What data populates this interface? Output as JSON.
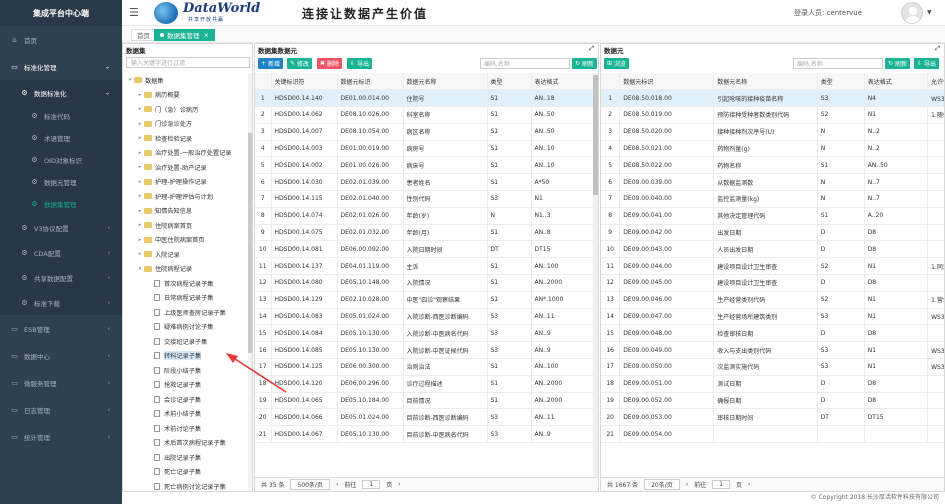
{
  "nav": {
    "brand": "集成平台中心端",
    "items": [
      {
        "label": "首页",
        "icon": "home-icon",
        "level": 1
      },
      {
        "label": "标准化管理",
        "icon": "desktop-icon",
        "level": 1,
        "expanded": true
      },
      {
        "label": "数据标准化",
        "icon": "gear-icon",
        "level": 2,
        "expanded": true
      },
      {
        "label": "标准代码",
        "icon": "gear-icon",
        "level": 3
      },
      {
        "label": "术语管理",
        "icon": "gear-icon",
        "level": 3
      },
      {
        "label": "OID对象标识",
        "icon": "gear-icon",
        "level": 3
      },
      {
        "label": "数据元管理",
        "icon": "gear-icon",
        "level": 3
      },
      {
        "label": "数据集管理",
        "icon": "gear-icon",
        "level": 3,
        "selected": true
      },
      {
        "label": "V3协议配置",
        "icon": "gear-icon",
        "level": 2
      },
      {
        "label": "CDA配置",
        "icon": "gear-icon",
        "level": 2
      },
      {
        "label": "共享数据配置",
        "icon": "gear-icon",
        "level": 2
      },
      {
        "label": "标准下载",
        "icon": "gear-icon",
        "level": 2
      },
      {
        "label": "ESB管理",
        "icon": "desktop-icon",
        "level": 1
      },
      {
        "label": "数据中心",
        "icon": "desktop-icon",
        "level": 1
      },
      {
        "label": "微服务管理",
        "icon": "desktop-icon",
        "level": 1
      },
      {
        "label": "日志管理",
        "icon": "desktop-icon",
        "level": 1
      },
      {
        "label": "统计管理",
        "icon": "desktop-icon",
        "level": 1
      }
    ]
  },
  "header": {
    "logo_text": "DataWorld",
    "logo_sub": "共享开放共赢",
    "slogan": "连接让数据产生价值",
    "login_label": "登录人员:",
    "user": "centervue"
  },
  "tabs": [
    {
      "label": "首页",
      "active": false
    },
    {
      "label": "数据集管理",
      "active": true
    }
  ],
  "tree": {
    "title": "数据集",
    "search_placeholder": "输入关键字进行过滤",
    "nodes": [
      {
        "label": "数据集",
        "type": "folder",
        "depth": 0,
        "open": true
      },
      {
        "label": "病历概要",
        "type": "folder",
        "depth": 1
      },
      {
        "label": "门（急）诊病历",
        "type": "folder",
        "depth": 1
      },
      {
        "label": "门诊急诊处方",
        "type": "folder",
        "depth": 1
      },
      {
        "label": "检查检验记录",
        "type": "folder",
        "depth": 1
      },
      {
        "label": "治疗处置-一般治疗处置记录",
        "type": "folder",
        "depth": 1
      },
      {
        "label": "治疗处置-助产记录",
        "type": "folder",
        "depth": 1
      },
      {
        "label": "护理-护理操作记录",
        "type": "folder",
        "depth": 1
      },
      {
        "label": "护理-护理评估与计划",
        "type": "folder",
        "depth": 1
      },
      {
        "label": "知情告知信息",
        "type": "folder",
        "depth": 1
      },
      {
        "label": "住院病案首页",
        "type": "folder",
        "depth": 1
      },
      {
        "label": "中医住院病案首页",
        "type": "folder",
        "depth": 1
      },
      {
        "label": "入院记录",
        "type": "folder",
        "depth": 1
      },
      {
        "label": "住院病程记录",
        "type": "folder",
        "depth": 1,
        "open": true
      },
      {
        "label": "首次病程记录子集",
        "type": "file",
        "depth": 2
      },
      {
        "label": "日常病程记录子集",
        "type": "file",
        "depth": 2
      },
      {
        "label": "上级医师查房记录子集",
        "type": "file",
        "depth": 2
      },
      {
        "label": "疑难病例讨论子集",
        "type": "file",
        "depth": 2
      },
      {
        "label": "交接班记录子集",
        "type": "file",
        "depth": 2
      },
      {
        "label": "转科记录子集",
        "type": "file",
        "depth": 2,
        "selected": true
      },
      {
        "label": "阶段小结子集",
        "type": "file",
        "depth": 2
      },
      {
        "label": "抢救记录子集",
        "type": "file",
        "depth": 2
      },
      {
        "label": "会诊记录子集",
        "type": "file",
        "depth": 2
      },
      {
        "label": "术前小结子集",
        "type": "file",
        "depth": 2
      },
      {
        "label": "术前讨论子集",
        "type": "file",
        "depth": 2
      },
      {
        "label": "术后首次病程记录子集",
        "type": "file",
        "depth": 2
      },
      {
        "label": "出院记录子集",
        "type": "file",
        "depth": 2
      },
      {
        "label": "死亡记录子集",
        "type": "file",
        "depth": 2
      },
      {
        "label": "死亡病例讨论记录子集",
        "type": "file",
        "depth": 2
      }
    ]
  },
  "mid": {
    "title": "数据集数据元",
    "buttons": {
      "add": "新增",
      "edit": "修改",
      "delete": "删除",
      "export": "导出",
      "refresh": "刷新"
    },
    "search_placeholder": "编码,名称",
    "columns": [
      "",
      "关键标识符",
      "数据元标识",
      "数据元名称",
      "类型",
      "表达格式"
    ],
    "rows": [
      [
        "1",
        "HDSD00.14.140",
        "DE01.00.014.00",
        "住院号",
        "S1",
        "AN..18"
      ],
      [
        "2",
        "HDSD00.14.062",
        "DE08.10.026.00",
        "科室名称",
        "S1",
        "AN..50"
      ],
      [
        "3",
        "HDSD00.14.007",
        "DE08.10.054.00",
        "病区名称",
        "S1",
        "AN..50"
      ],
      [
        "4",
        "HDSD00.14.003",
        "DE01.00.019.00",
        "病房号",
        "S1",
        "AN..10"
      ],
      [
        "5",
        "HDSD00.14.002",
        "DE01.00.026.00",
        "病床号",
        "S1",
        "AN..10"
      ],
      [
        "6",
        "HDSD00.14.030",
        "DE02.01.039.00",
        "患者姓名",
        "S1",
        "A*50"
      ],
      [
        "7",
        "HDSD00.14.115",
        "DE02.01.040.00",
        "性别代码",
        "S3",
        "N1"
      ],
      [
        "8",
        "HDSD00.14.074",
        "DE02.01.026.00",
        "年龄(岁)",
        "N",
        "N1..3"
      ],
      [
        "9",
        "HDSD00.14.075",
        "DE02.01.032.00",
        "年龄(月)",
        "S1",
        "AN..8"
      ],
      [
        "10",
        "HDSD00.14.081",
        "DE06.00.092.00",
        "入院日期时间",
        "DT",
        "DT15"
      ],
      [
        "11",
        "HDSD00.14.137",
        "DE04.01.119.00",
        "主诉",
        "S1",
        "AN..100"
      ],
      [
        "12",
        "HDSD00.14.080",
        "DE05.10.148.00",
        "入院情况",
        "S1",
        "AN..2000"
      ],
      [
        "13",
        "HDSD00.14.129",
        "DE02.10.028.00",
        "中医\"四诊\"观察结果",
        "S1",
        "AN*.1000"
      ],
      [
        "14",
        "HDSD00.14.083",
        "DE05.01.024.00",
        "入院诊断-西医诊断编码",
        "S3",
        "AN..11"
      ],
      [
        "15",
        "HDSD00.14.084",
        "DE05.10.130.00",
        "入院诊断-中医病名代码",
        "S3",
        "AN..9"
      ],
      [
        "16",
        "HDSD00.14.085",
        "DE05.10.130.00",
        "入院诊断-中医证候代码",
        "S3",
        "AN..9"
      ],
      [
        "17",
        "HDSD00.14.125",
        "DE06.00.300.00",
        "治则治法",
        "S1",
        "AN..100"
      ],
      [
        "18",
        "HDSD00.14.120",
        "DE06.00.296.00",
        "诊疗过程描述",
        "S1",
        "AN..2000"
      ],
      [
        "19",
        "HDSD00.14.065",
        "DE05.10.184.00",
        "目前情况",
        "S1",
        "AN..2000"
      ],
      [
        "20",
        "HDSD00.14.066",
        "DE05.01.024.00",
        "目前诊断-西医诊断编码",
        "S3",
        "AN..11"
      ],
      [
        "21",
        "HDSD00.14.067",
        "DE05.10.130.00",
        "目前诊断-中医病名代码",
        "S3",
        "AN..9"
      ]
    ],
    "pager": {
      "total": "共 35 条",
      "page_size": "500条/页",
      "prev": "前往",
      "page": "1",
      "page_unit": "页"
    }
  },
  "right": {
    "title": "数据元",
    "buttons": {
      "browse": "浏览",
      "refresh": "刷新",
      "export": "导出"
    },
    "search_placeholder": "编码,名称",
    "columns": [
      "",
      "数据元标识",
      "数据元名称",
      "类型",
      "表达格式",
      "允许值"
    ],
    "rows": [
      [
        "1",
        "DE08.50.018.00",
        "引起呛咳的接种疫苗名称",
        "S3",
        "N4",
        "WS364.16 卫生信"
      ],
      [
        "2",
        "DE08.50.019.00",
        "预防接种受种者数类别代码",
        "S2",
        "N1",
        "1.随便机,2.有证"
      ],
      [
        "3",
        "DE08.50.020.00",
        "接种接种剂次序号(U)",
        "N",
        "N..2",
        ""
      ],
      [
        "4",
        "DE08.50.021.00",
        "药物剂量(g)",
        "N",
        "N..2",
        ""
      ],
      [
        "5",
        "DE08.50.022.00",
        "药物名称",
        "S1",
        "AN..50",
        ""
      ],
      [
        "6",
        "DE09.00.039.00",
        "从数据监测数",
        "N",
        "N..7",
        ""
      ],
      [
        "7",
        "DE09.00.040.00",
        "监控监测量(kg)",
        "N",
        "N..7",
        ""
      ],
      [
        "8",
        "DE09.00.041.00",
        "其他决定管理代码",
        "S1",
        "A..20",
        ""
      ],
      [
        "9",
        "DE09.00.042.00",
        "出发日期",
        "D",
        "D8",
        ""
      ],
      [
        "10",
        "DE09.00.043.00",
        "人员出发日期",
        "D",
        "D8",
        ""
      ],
      [
        "11",
        "DE09.00.044.00",
        "建设项目设计卫生审查",
        "S2",
        "N1",
        "1.同意,2.未同意"
      ],
      [
        "12",
        "DE09.00.045.00",
        "建设项目设计卫生审查",
        "D",
        "D8",
        ""
      ],
      [
        "13",
        "DE09.00.046.00",
        "生产经营类别代码",
        "S2",
        "N1",
        "1.营业,2.关闭"
      ],
      [
        "14",
        "DE09.00.047.00",
        "生产经营场所建筑类别",
        "S3",
        "N1",
        "WS364.17 卫生信"
      ],
      [
        "15",
        "DE09.00.048.00",
        "检查审核日期",
        "D",
        "D8",
        ""
      ],
      [
        "16",
        "DE09.00.049.00",
        "收入与支出类别代码",
        "S3",
        "N1",
        "WS364.17 卫生信"
      ],
      [
        "17",
        "DE09.00.050.00",
        "次监测实施代码",
        "S3",
        "N1",
        "WS364.17 卫生信"
      ],
      [
        "18",
        "DE09.00.051.00",
        "测试日期",
        "D",
        "D8",
        ""
      ],
      [
        "19",
        "DE09.00.052.00",
        "确报日期",
        "D",
        "D8",
        ""
      ],
      [
        "20",
        "DE09.00.053.00",
        "审核日期时间",
        "DT",
        "DT15",
        ""
      ],
      [
        "21",
        "DE09.00.054.00",
        "",
        "",
        "",
        ""
      ]
    ],
    "pager": {
      "total": "共 1667 条",
      "page_size": "20条/页",
      "prev": "前往",
      "page": "1",
      "page_unit": "页"
    }
  },
  "footer": {
    "copyright": "© Copyright 2018 长沙厚活软件科技有限公司"
  },
  "colors": {
    "nav_bg": "#2f4050",
    "accent": "#1ab394",
    "primary": "#1c84c6",
    "danger": "#ed5565",
    "selected_row": "#dff0fb",
    "arrow": "#e53935"
  }
}
